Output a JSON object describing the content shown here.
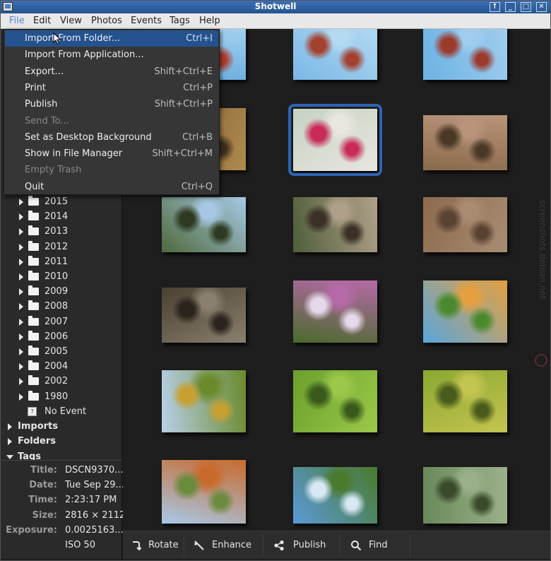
{
  "window": {
    "title": "Shotwell"
  },
  "menubar": [
    "File",
    "Edit",
    "View",
    "Photos",
    "Events",
    "Tags",
    "Help"
  ],
  "file_menu": [
    {
      "label": "Import From Folder...",
      "accel": "Ctrl+I",
      "state": "hover"
    },
    {
      "label": "Import From Application...",
      "accel": "",
      "state": "normal"
    },
    {
      "label": "Export...",
      "accel": "Shift+Ctrl+E",
      "state": "normal"
    },
    {
      "label": "Print",
      "accel": "Ctrl+P",
      "state": "normal"
    },
    {
      "label": "Publish",
      "accel": "Shift+Ctrl+P",
      "state": "normal"
    },
    {
      "label": "Send To...",
      "accel": "",
      "state": "disabled"
    },
    {
      "label": "Set as Desktop Background",
      "accel": "Ctrl+B",
      "state": "normal"
    },
    {
      "label": "Show in File Manager",
      "accel": "Shift+Ctrl+M",
      "state": "normal"
    },
    {
      "label": "Empty Trash",
      "accel": "",
      "state": "disabled"
    },
    {
      "label": "Quit",
      "accel": "Ctrl+Q",
      "state": "normal"
    }
  ],
  "sidebar": {
    "years": [
      "2015",
      "2014",
      "2013",
      "2012",
      "2011",
      "2010",
      "2009",
      "2008",
      "2007",
      "2006",
      "2005",
      "2004",
      "2002",
      "1980"
    ],
    "no_event": "No Event",
    "sections": [
      {
        "label": "Imports",
        "expanded": false
      },
      {
        "label": "Folders",
        "expanded": false
      },
      {
        "label": "Tags",
        "expanded": true
      }
    ]
  },
  "info": [
    {
      "label": "Title:",
      "value": "DSCN9370..."
    },
    {
      "label": "Date:",
      "value": "Tue Sep 29..."
    },
    {
      "label": "Time:",
      "value": "2:23:17 PM"
    },
    {
      "label": "Size:",
      "value": "2816 × 2112"
    },
    {
      "label": "Exposure:",
      "value": "0.0025163..."
    },
    {
      "label": "",
      "value": "ISO 50"
    }
  ],
  "toolbar": [
    {
      "label": "Rotate",
      "icon": "rotate-icon"
    },
    {
      "label": "Enhance",
      "icon": "enhance-wand-icon"
    },
    {
      "label": "Publish",
      "icon": "share-icon"
    },
    {
      "label": "Find",
      "icon": "search-icon"
    }
  ],
  "photos": [
    {
      "name": "red-leaves-sky",
      "colors": [
        "#6fb0e0",
        "#a8d4f0",
        "#b03c2a"
      ]
    },
    {
      "name": "red-leaves-sky-2",
      "colors": [
        "#7ab8e6",
        "#b4daf2",
        "#a4402e"
      ]
    },
    {
      "name": "red-leaves-sky-3",
      "colors": [
        "#6cb2e4",
        "#a0cdee",
        "#9c3a2c"
      ]
    },
    {
      "name": "autumn-trunk",
      "colors": [
        "#7a5c34",
        "#b08a4e",
        "#3e2f1c"
      ]
    },
    {
      "name": "pink-flowers",
      "colors": [
        "#c6d2c2",
        "#e8e6df",
        "#c82a5a"
      ]
    },
    {
      "name": "forest-floor-tree",
      "colors": [
        "#8a6a4c",
        "#b8947a",
        "#4a3826"
      ]
    },
    {
      "name": "pine-forest-sky",
      "colors": [
        "#4f6a3c",
        "#a6c8e4",
        "#2e3a22"
      ]
    },
    {
      "name": "tree-trunk-path",
      "colors": [
        "#4f5e3a",
        "#b0a089",
        "#3a3026"
      ]
    },
    {
      "name": "squirrel-ground",
      "colors": [
        "#8c6a4e",
        "#a88c72",
        "#5a4232"
      ]
    },
    {
      "name": "woodpecker-trunks",
      "colors": [
        "#4a4030",
        "#8a8070",
        "#2a241c"
      ]
    },
    {
      "name": "purple-flowers",
      "colors": [
        "#4a6a2c",
        "#b66aa8",
        "#e4d8ea"
      ]
    },
    {
      "name": "maple-sky",
      "colors": [
        "#5aa6dc",
        "#e4a040",
        "#4a8a2c"
      ]
    },
    {
      "name": "leaves-sky-yellow",
      "colors": [
        "#b8d0e8",
        "#6a8a2c",
        "#c8a030"
      ]
    },
    {
      "name": "green-leaves",
      "colors": [
        "#6aa02c",
        "#9cc84a",
        "#3a5a1c"
      ]
    },
    {
      "name": "yellow-green-leaves",
      "colors": [
        "#8aa830",
        "#c4c450",
        "#4a5a1c"
      ]
    },
    {
      "name": "orange-leaves-sky",
      "colors": [
        "#a8c8e8",
        "#c86a2c",
        "#6a8a3c"
      ]
    },
    {
      "name": "meadow-forest",
      "colors": [
        "#5a9ad8",
        "#4a7a2c",
        "#d8e8f4"
      ]
    },
    {
      "name": "pine-needles",
      "colors": [
        "#6a8a5a",
        "#9ab08a",
        "#3a4a2c"
      ]
    }
  ],
  "watermark": "screenshots.debian.net"
}
